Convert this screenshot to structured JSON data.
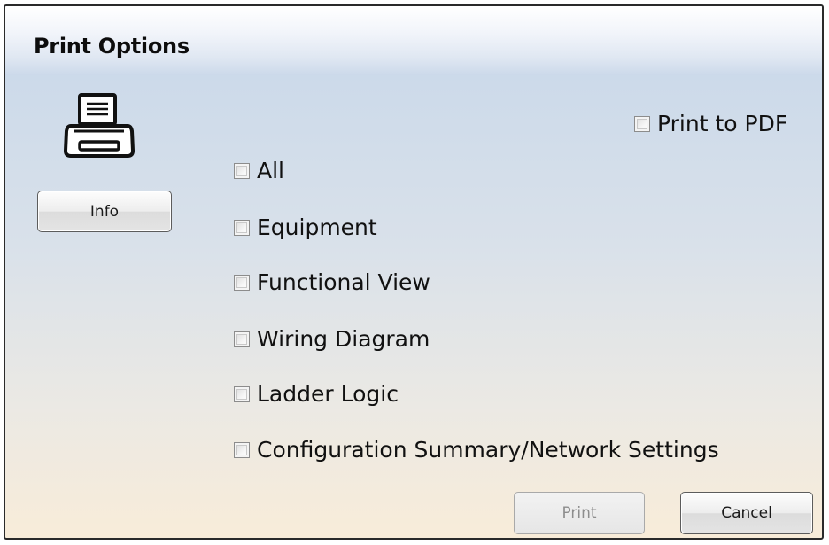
{
  "dialog": {
    "title": "Print Options"
  },
  "icons": {
    "printer": "printer-icon"
  },
  "buttons": {
    "info_label": "Info",
    "print_label": "Print",
    "cancel_label": "Cancel"
  },
  "options": {
    "print_to_pdf": {
      "label": "Print to PDF",
      "checked": false
    },
    "items": [
      {
        "label": "All",
        "checked": false
      },
      {
        "label": "Equipment",
        "checked": false
      },
      {
        "label": "Functional View",
        "checked": false
      },
      {
        "label": "Wiring Diagram",
        "checked": false
      },
      {
        "label": "Ladder Logic",
        "checked": false
      },
      {
        "label": "Configuration Summary/Network Settings",
        "checked": false
      }
    ]
  },
  "states": {
    "print_enabled": false
  }
}
